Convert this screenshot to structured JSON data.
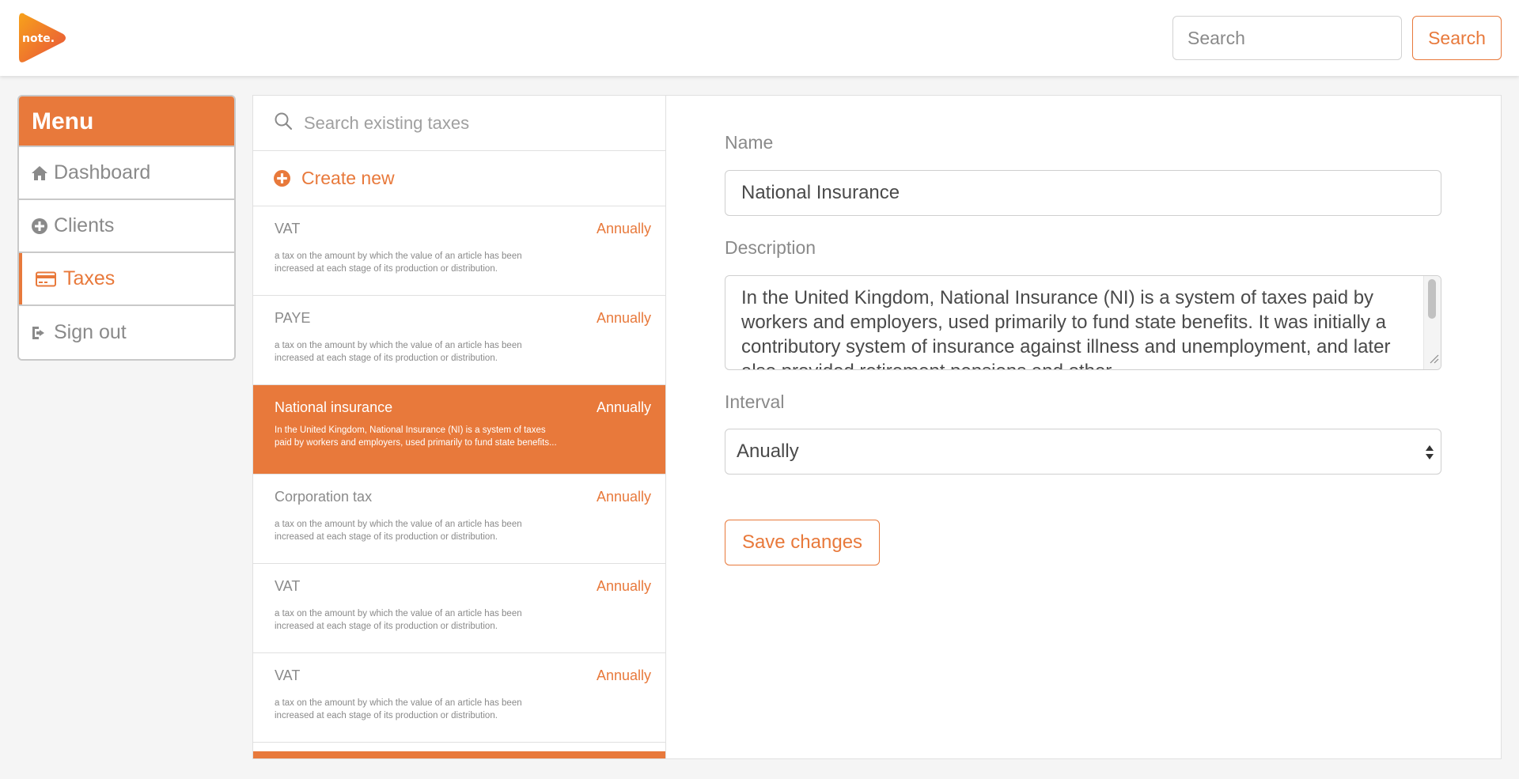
{
  "brand": {
    "logo_text": "note.",
    "accent": "#e8793b"
  },
  "header": {
    "search_placeholder": "Search",
    "search_button_label": "Search"
  },
  "menu": {
    "title": "Menu",
    "items": [
      {
        "label": "Dashboard",
        "icon": "home-icon",
        "active": false
      },
      {
        "label": "Clients",
        "icon": "plus-circle-icon",
        "active": false
      },
      {
        "label": "Taxes",
        "icon": "credit-card-icon",
        "active": true
      },
      {
        "label": "Sign out",
        "icon": "sign-out-icon",
        "active": false
      }
    ]
  },
  "tax_list": {
    "search_placeholder": "Search existing taxes",
    "create_label": "Create new",
    "items": [
      {
        "name": "VAT",
        "interval": "Annually",
        "description": "a tax on the amount by which the value of an article has been increased at each stage of its production or distribution.",
        "selected": false
      },
      {
        "name": "PAYE",
        "interval": "Annually",
        "description": "a tax on the amount by which the value of an article has been increased at each stage of its production or distribution.",
        "selected": false
      },
      {
        "name": "National insurance",
        "interval": "Annually",
        "description": "In the United Kingdom, National Insurance (NI) is a system of taxes paid by workers and employers, used primarily to fund state benefits...",
        "selected": true
      },
      {
        "name": "Corporation tax",
        "interval": "Annually",
        "description": "a tax on the amount by which the value of an article has been increased at each stage of its production or distribution.",
        "selected": false
      },
      {
        "name": "VAT",
        "interval": "Annually",
        "description": "a tax on the amount by which the value of an article has been increased at each stage of its production or distribution.",
        "selected": false
      },
      {
        "name": "VAT",
        "interval": "Annually",
        "description": "a tax on the amount by which the value of an article has been increased at each stage of its production or distribution.",
        "selected": false
      }
    ]
  },
  "editor": {
    "name_label": "Name",
    "name_value": "National Insurance",
    "description_label": "Description",
    "description_value": "In the United Kingdom, National Insurance (NI) is a system of taxes paid by workers and employers, used primarily to fund state benefits. It was initially a contributory system of insurance against illness and unemployment, and later also provided retirement pensions and other",
    "interval_label": "Interval",
    "interval_value": "Anually",
    "save_label": "Save changes"
  }
}
